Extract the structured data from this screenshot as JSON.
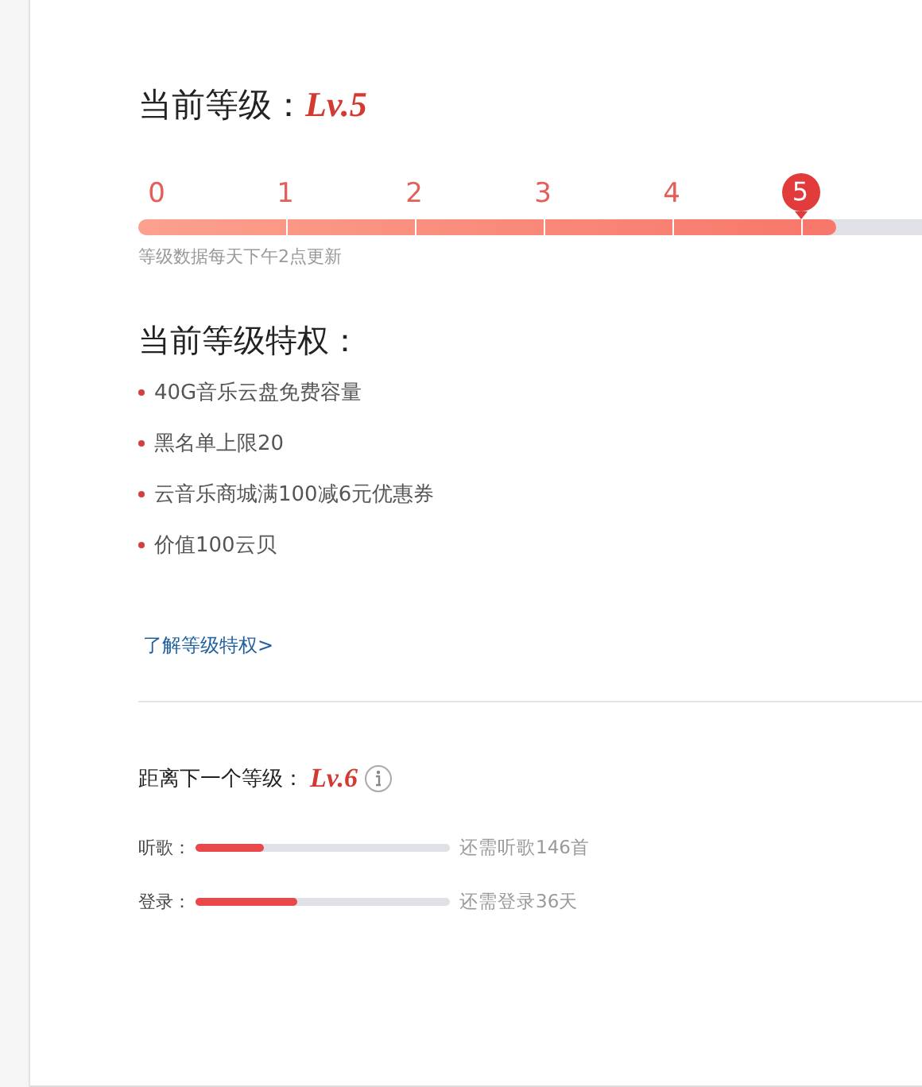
{
  "current_level": {
    "label": "当前等级：",
    "value": "Lv.5"
  },
  "level_bar": {
    "ticks": [
      {
        "label": "0",
        "selected": false
      },
      {
        "label": "1",
        "selected": false
      },
      {
        "label": "2",
        "selected": false
      },
      {
        "label": "3",
        "selected": false
      },
      {
        "label": "4",
        "selected": false
      },
      {
        "label": "5",
        "selected": true
      }
    ],
    "level": 0.89,
    "note": "等级数据每天下午2点更新"
  },
  "privileges": {
    "title": "当前等级特权：",
    "items": [
      "40G音乐云盘免费容量",
      "黑名单上限20",
      "云音乐商城满100减6元优惠券",
      "价值100云贝"
    ],
    "link": "了解等级特权>"
  },
  "next_level": {
    "label": "距离下一个等级：",
    "value": "Lv.6",
    "requirements": [
      {
        "label": "听歌：",
        "level": 0.27,
        "remaining": "还需听歌146首"
      },
      {
        "label": "登录：",
        "level": 0.4,
        "remaining": "还需登录36天"
      }
    ]
  }
}
